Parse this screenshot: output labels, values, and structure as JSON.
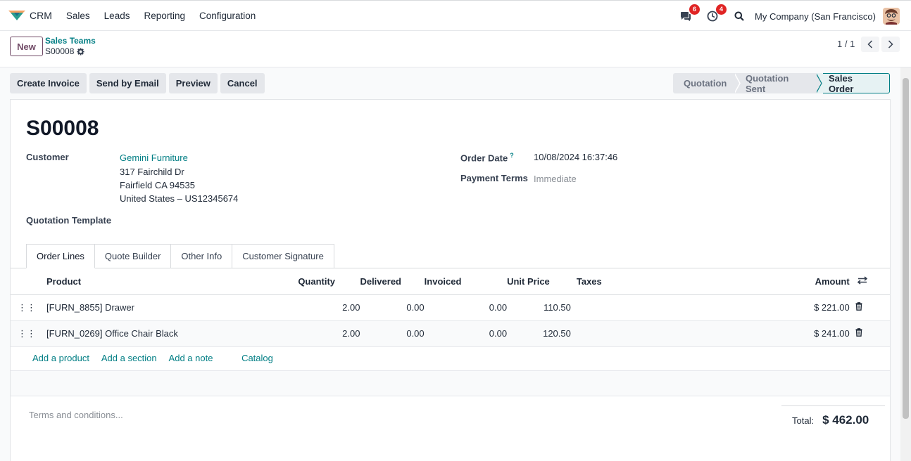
{
  "nav": {
    "app_name": "CRM",
    "menu": [
      "Sales",
      "Leads",
      "Reporting",
      "Configuration"
    ],
    "chat_badge": "6",
    "activity_badge": "4",
    "company": "My Company (San Francisco)"
  },
  "control": {
    "new_label": "New",
    "breadcrumb_parent": "Sales Teams",
    "breadcrumb_current": "S00008",
    "pager": "1 / 1"
  },
  "actions": [
    "Create Invoice",
    "Send by Email",
    "Preview",
    "Cancel"
  ],
  "status_steps": [
    "Quotation",
    "Quotation Sent",
    "Sales Order"
  ],
  "form": {
    "title": "S00008",
    "customer_label": "Customer",
    "customer_name": "Gemini Furniture",
    "address_line1": "317 Fairchild Dr",
    "address_line2": "Fairfield CA 94535",
    "address_line3": "United States – US12345674",
    "quotation_template_label": "Quotation Template",
    "order_date_label": "Order Date",
    "order_date_help": "?",
    "order_date_value": "10/08/2024 16:37:46",
    "payment_terms_label": "Payment Terms",
    "payment_terms_value": "Immediate"
  },
  "tabs": [
    "Order Lines",
    "Quote Builder",
    "Other Info",
    "Customer Signature"
  ],
  "order_lines": {
    "columns": {
      "product": "Product",
      "quantity": "Quantity",
      "delivered": "Delivered",
      "invoiced": "Invoiced",
      "unit_price": "Unit Price",
      "taxes": "Taxes",
      "amount": "Amount"
    },
    "rows": [
      {
        "product": "[FURN_8855] Drawer",
        "quantity": "2.00",
        "delivered": "0.00",
        "invoiced": "0.00",
        "unit_price": "110.50",
        "taxes": "",
        "amount": "$ 221.00"
      },
      {
        "product": "[FURN_0269] Office Chair Black",
        "quantity": "2.00",
        "delivered": "0.00",
        "invoiced": "0.00",
        "unit_price": "120.50",
        "taxes": "",
        "amount": "$ 241.00"
      }
    ],
    "add_links": [
      "Add a product",
      "Add a section",
      "Add a note",
      "Catalog"
    ]
  },
  "footer": {
    "terms_placeholder": "Terms and conditions...",
    "total_label": "Total:",
    "total_value": "$ 462.00"
  },
  "colors": {
    "brand": "#714b67",
    "link": "#017e84",
    "badge": "#e02424"
  }
}
